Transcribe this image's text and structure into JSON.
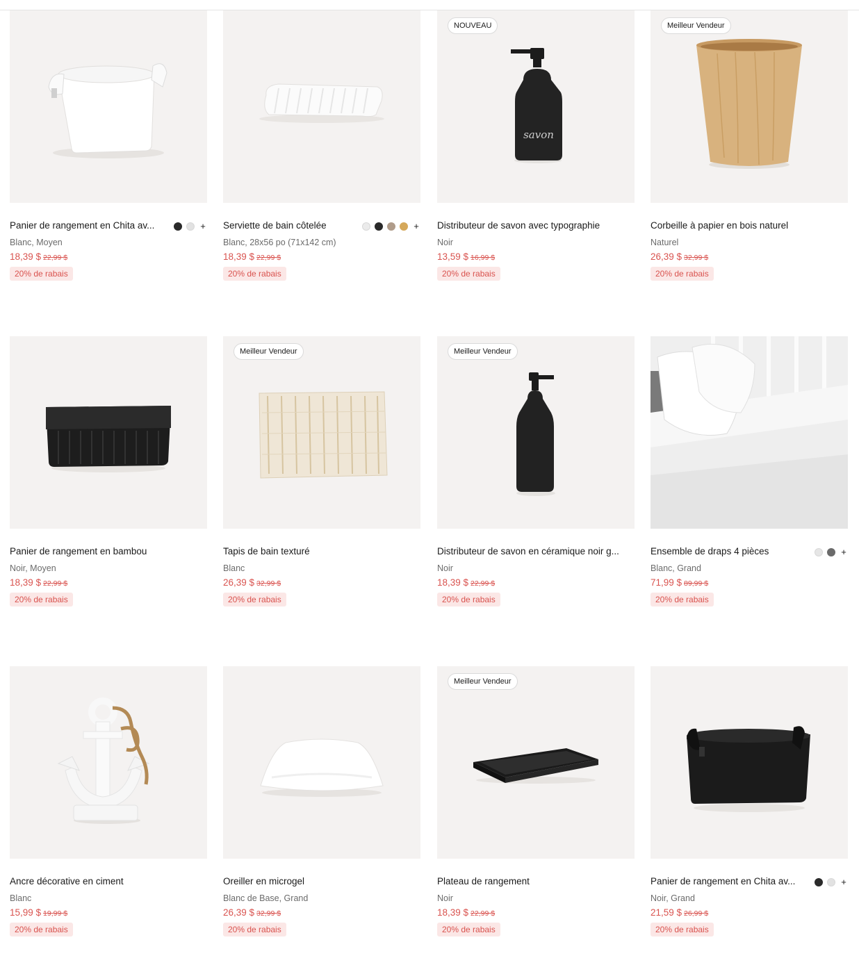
{
  "products": [
    {
      "title": "Panier de rangement en Chita av...",
      "variant": "Blanc, Moyen",
      "price": "18,39 $",
      "old_price": "22,99 $",
      "discount": "20% de rabais",
      "badge": "",
      "swatches": [
        "#2a2a2a",
        "#e2e2e2"
      ],
      "more_swatches": "+",
      "image_icon": "white-storage-basket-icon"
    },
    {
      "title": "Serviette de bain côtelée",
      "variant": "Blanc, 28x56 po (71x142 cm)",
      "price": "18,39 $",
      "old_price": "22,99 $",
      "discount": "20% de rabais",
      "badge": "",
      "swatches": [
        "#ebebeb",
        "#2a2a2a",
        "#b09c8a",
        "#d5a85a"
      ],
      "more_swatches": "+",
      "image_icon": "folded-towel-icon"
    },
    {
      "title": "Distributeur de savon avec typographie",
      "variant": "Noir",
      "price": "13,59 $",
      "old_price": "16,99 $",
      "discount": "20% de rabais",
      "badge": "NOUVEAU",
      "swatches": [],
      "more_swatches": "",
      "image_icon": "soap-dispenser-icon",
      "bottle_text": "savon"
    },
    {
      "title": "Corbeille à papier en bois naturel",
      "variant": "Naturel",
      "price": "26,39 $",
      "old_price": "32,99 $",
      "discount": "20% de rabais",
      "badge": "Meilleur Vendeur",
      "swatches": [],
      "more_swatches": "",
      "image_icon": "wood-wastebasket-icon"
    },
    {
      "title": "Panier de rangement en bambou",
      "variant": "Noir, Moyen",
      "price": "18,39 $",
      "old_price": "22,99 $",
      "discount": "20% de rabais",
      "badge": "",
      "swatches": [],
      "more_swatches": "",
      "image_icon": "bamboo-basket-icon"
    },
    {
      "title": "Tapis de bain texturé",
      "variant": "Blanc",
      "price": "26,39 $",
      "old_price": "32,99 $",
      "discount": "20% de rabais",
      "badge": "Meilleur Vendeur",
      "swatches": [],
      "more_swatches": "",
      "image_icon": "bath-mat-icon"
    },
    {
      "title": "Distributeur de savon en céramique noir g...",
      "variant": "Noir",
      "price": "18,39 $",
      "old_price": "22,99 $",
      "discount": "20% de rabais",
      "badge": "Meilleur Vendeur",
      "swatches": [],
      "more_swatches": "",
      "image_icon": "ceramic-soap-dispenser-icon"
    },
    {
      "title": "Ensemble de draps 4 pièces",
      "variant": "Blanc, Grand",
      "price": "71,99 $",
      "old_price": "89,99 $",
      "discount": "20% de rabais",
      "badge": "",
      "swatches": [
        "#e6e6e6",
        "#6a6a6a"
      ],
      "more_swatches": "+",
      "image_icon": "bed-sheets-icon"
    },
    {
      "title": "Ancre décorative en ciment",
      "variant": "Blanc",
      "price": "15,99 $",
      "old_price": "19,99 $",
      "discount": "20% de rabais",
      "badge": "",
      "swatches": [],
      "more_swatches": "",
      "image_icon": "anchor-decor-icon"
    },
    {
      "title": "Oreiller en microgel",
      "variant": "Blanc de Base, Grand",
      "price": "26,39 $",
      "old_price": "32,99 $",
      "discount": "20% de rabais",
      "badge": "",
      "swatches": [],
      "more_swatches": "",
      "image_icon": "pillow-icon"
    },
    {
      "title": "Plateau de rangement",
      "variant": "Noir",
      "price": "18,39 $",
      "old_price": "22,99 $",
      "discount": "20% de rabais",
      "badge": "Meilleur Vendeur",
      "swatches": [],
      "more_swatches": "",
      "image_icon": "storage-tray-icon"
    },
    {
      "title": "Panier de rangement en Chita av...",
      "variant": "Noir, Grand",
      "price": "21,59 $",
      "old_price": "26,99 $",
      "discount": "20% de rabais",
      "badge": "",
      "swatches": [
        "#2a2a2a",
        "#e2e2e2"
      ],
      "more_swatches": "+",
      "image_icon": "black-storage-basket-icon"
    }
  ],
  "colors": {
    "accent": "#d9534f",
    "discount_bg": "#fbe7e6",
    "image_bg": "#f4f2f1"
  }
}
